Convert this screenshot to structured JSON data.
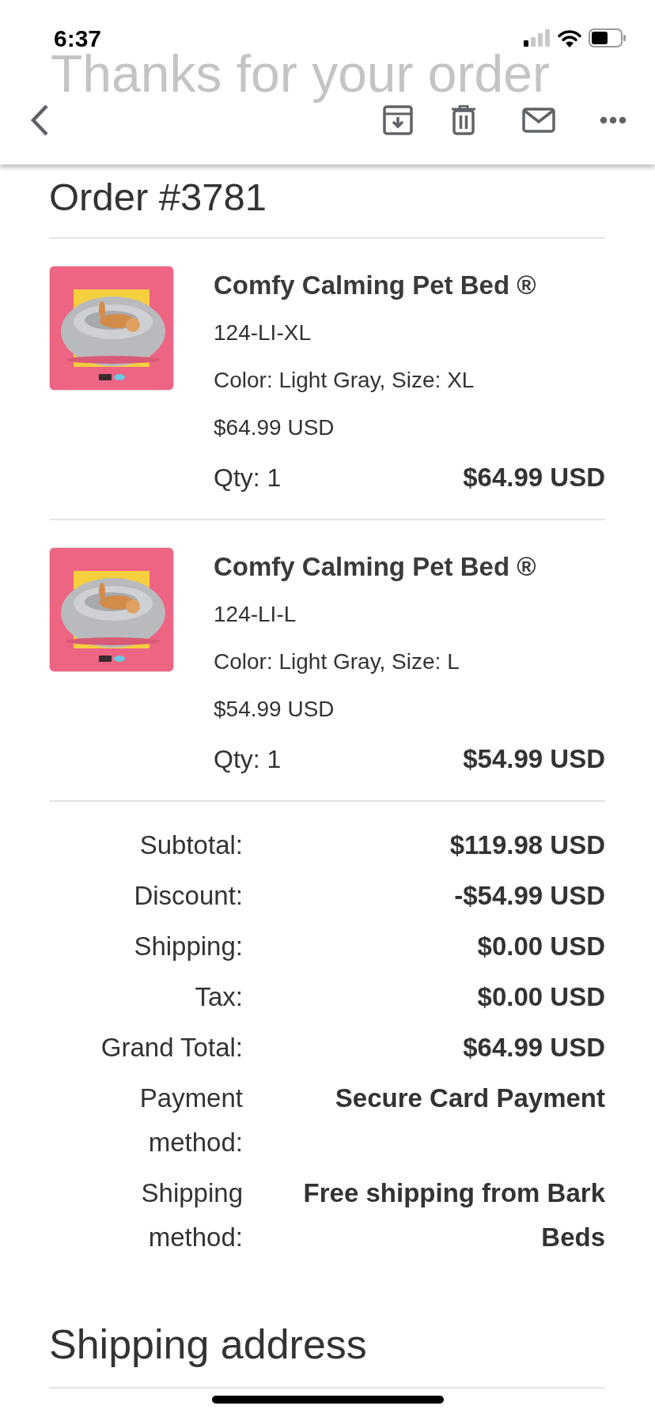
{
  "status_bar": {
    "time": "6:37"
  },
  "header": {
    "faded_title": "Thanks for your order"
  },
  "order": {
    "title": "Order #3781",
    "items": [
      {
        "name": "Comfy Calming Pet Bed ®",
        "sku": "124-LI-XL",
        "variant": "Color: Light Gray, Size: XL",
        "unit_price": "$64.99 USD",
        "quantity": "Qty: 1",
        "line_total": "$64.99 USD"
      },
      {
        "name": "Comfy Calming Pet Bed ®",
        "sku": "124-LI-L",
        "variant": "Color: Light Gray, Size: L",
        "unit_price": "$54.99 USD",
        "quantity": "Qty: 1",
        "line_total": "$54.99 USD"
      }
    ],
    "summary": [
      {
        "label": "Subtotal:",
        "value": "$119.98 USD"
      },
      {
        "label": "Discount:",
        "value": "-$54.99 USD"
      },
      {
        "label": "Shipping:",
        "value": "$0.00 USD"
      },
      {
        "label": "Tax:",
        "value": "$0.00 USD"
      },
      {
        "label": "Grand Total:",
        "value": "$64.99 USD"
      },
      {
        "label": "Payment method:",
        "value": "Secure Card Payment"
      },
      {
        "label": "Shipping method:",
        "value": "Free shipping from Bark Beds"
      }
    ]
  },
  "shipping_address": {
    "title": "Shipping address"
  }
}
